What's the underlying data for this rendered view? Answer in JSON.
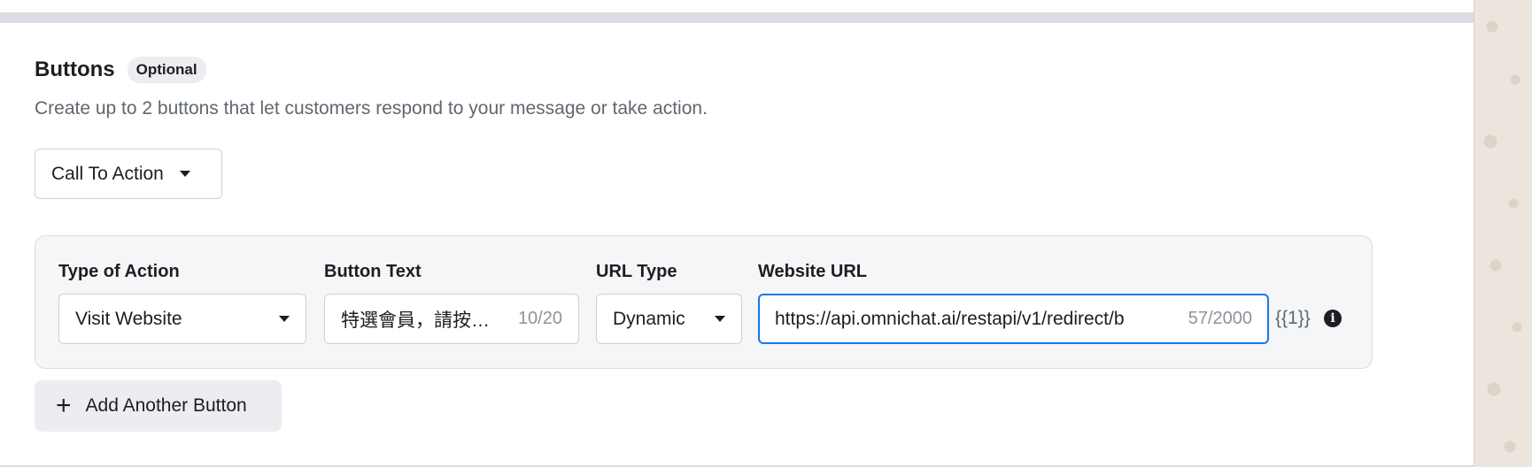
{
  "section": {
    "title": "Buttons",
    "badge": "Optional",
    "subtitle": "Create up to 2 buttons that let customers respond to your message or take action."
  },
  "button_category": {
    "selected": "Call To Action"
  },
  "action_row": {
    "type_of_action": {
      "label": "Type of Action",
      "value": "Visit Website"
    },
    "button_text": {
      "label": "Button Text",
      "value": "特選會員，請按…",
      "counter": "10/20"
    },
    "url_type": {
      "label": "URL Type",
      "value": "Dynamic"
    },
    "website_url": {
      "label": "Website URL",
      "value": "https://api.omnichat.ai/restapi/v1/redirect/b",
      "counter": "57/2000"
    },
    "variable_tag": "{{1}}"
  },
  "add_button": {
    "label": "Add Another Button"
  },
  "icons": {
    "caret": "caret-down-icon",
    "info": "info-icon",
    "plus": "plus-icon"
  },
  "colors": {
    "focus_border": "#1877f2",
    "divider": "#dadde1",
    "panel_background": "#ece5dd"
  }
}
